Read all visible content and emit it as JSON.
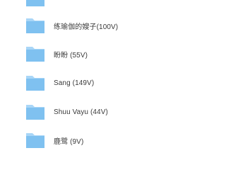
{
  "colors": {
    "folder_front": "#7fc1f0",
    "folder_back": "#a9d6f7",
    "text": "#3a3a3a",
    "background": "#ffffff"
  },
  "folders": [
    {
      "label": "",
      "icon": "folder-icon"
    },
    {
      "label": "练瑜伽的嫂子(100V)",
      "icon": "folder-icon"
    },
    {
      "label": "盼盼 (55V)",
      "icon": "folder-icon"
    },
    {
      "label": "Sang (149V)",
      "icon": "folder-icon"
    },
    {
      "label": "Shuu Vayu (44V)",
      "icon": "folder-icon"
    },
    {
      "label": "鹿鹭 (9V)",
      "icon": "folder-icon"
    }
  ]
}
